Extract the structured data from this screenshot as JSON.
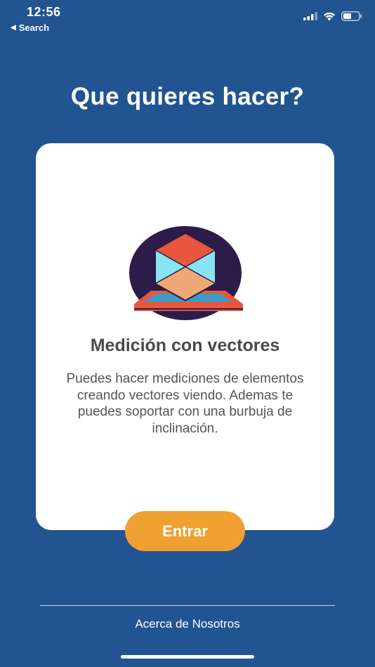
{
  "status_bar": {
    "time": "12:56",
    "back_label": "Search",
    "back_icon": "back-triangle-icon",
    "icons": [
      "signal-icon",
      "wifi-icon",
      "battery-icon"
    ]
  },
  "header": {
    "title": "Que quieres hacer?"
  },
  "card": {
    "illustration_icon": "vector-measure-icon",
    "title": "Medición con vectores",
    "description": "Puedes hacer mediciones de elementos creando vectores viendo. Ademas te puedes soportar con una burbuja de inclinación."
  },
  "actions": {
    "enter_label": "Entrar"
  },
  "footer": {
    "about_label": "Acerca de Nosotros"
  },
  "colors": {
    "background": "#215490",
    "card": "#ffffff",
    "button": "#f0a030",
    "text_dark": "#4a4a4a"
  }
}
